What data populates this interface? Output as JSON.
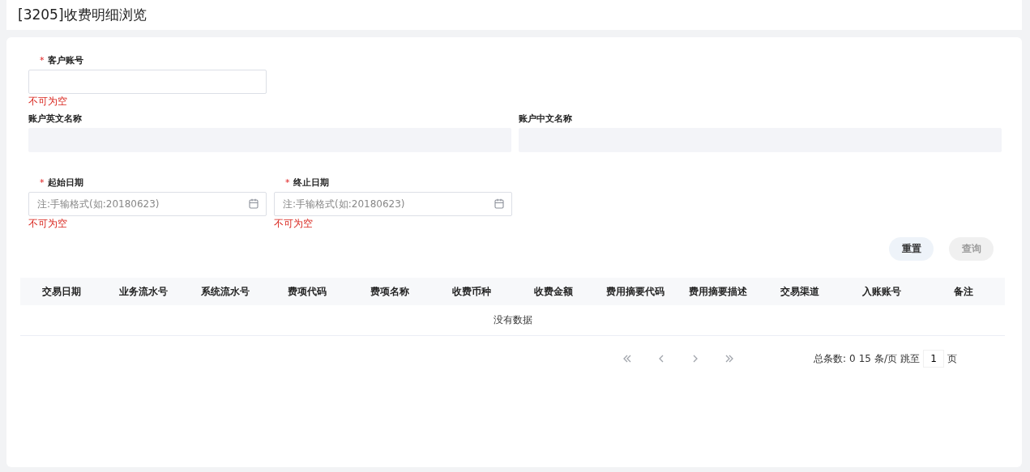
{
  "page_title": "[3205]收费明细浏览",
  "form_rows": [
    {
      "fields": [
        {
          "label": "客户账号",
          "required_mark": "*",
          "kind": "text",
          "disabled": false,
          "error": "不可为空"
        }
      ]
    },
    {
      "fields": [
        {
          "label": "账户英文名称",
          "kind": "text",
          "disabled": true
        },
        {
          "label": "账户中文名称",
          "kind": "text",
          "disabled": true
        }
      ]
    },
    {
      "fields": [
        {
          "label": "起始日期",
          "required_mark": "*",
          "kind": "date",
          "placeholder": "注:手输格式(如:20180623)",
          "disabled": false,
          "error": "不可为空"
        },
        {
          "label": "终止日期",
          "required_mark": "*",
          "kind": "date",
          "placeholder": "注:手输格式(如:20180623)",
          "disabled": false,
          "error": "不可为空"
        }
      ]
    }
  ],
  "buttons": [
    {
      "label": "重置",
      "disabled": false
    },
    {
      "label": "查询",
      "disabled": true
    }
  ],
  "table": {
    "columns": [
      "交易日期",
      "业务流水号",
      "系统流水号",
      "费项代码",
      "费项名称",
      "收费币种",
      "收费金额",
      "费用摘要代码",
      "费用摘要描述",
      "交易渠道",
      "入账账号",
      "备注"
    ],
    "empty_text": "没有数据"
  },
  "pagination": {
    "total_label": "总条数:",
    "total": "0",
    "page_size": "15",
    "page_size_unit": "条/页",
    "jump_label": "跳至",
    "page": "1",
    "page_unit": "页"
  }
}
